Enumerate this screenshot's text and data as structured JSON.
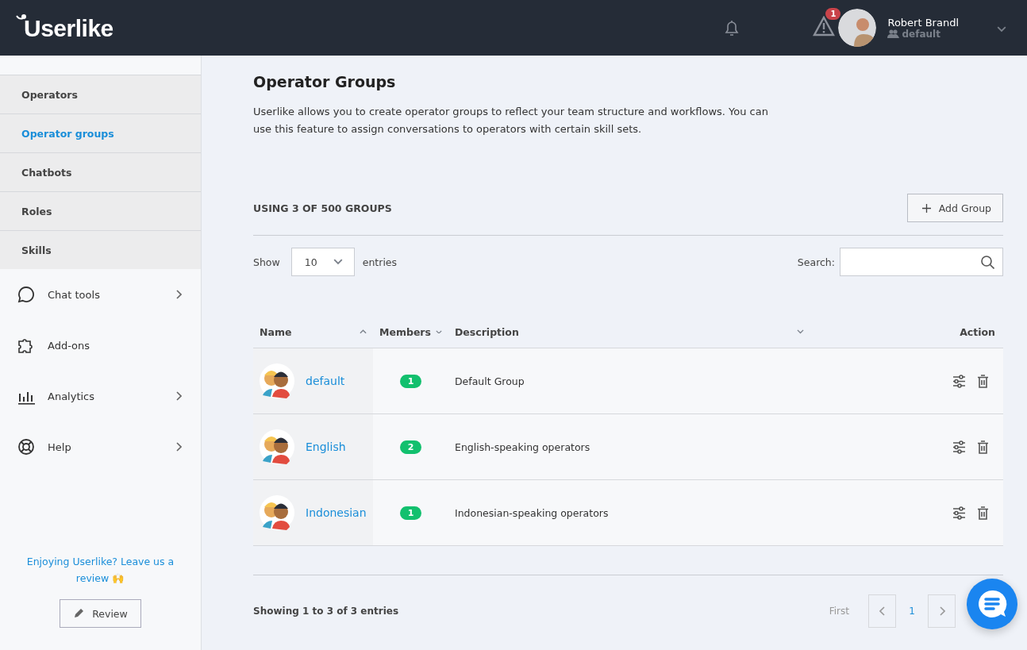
{
  "header": {
    "logo": "Userlike",
    "alert_count": "1",
    "user": {
      "name": "Robert Brandl",
      "group": "default"
    }
  },
  "sidebar": {
    "subitems": [
      {
        "label": "Operators",
        "selected": false
      },
      {
        "label": "Operator groups",
        "selected": true
      },
      {
        "label": "Chatbots",
        "selected": false
      },
      {
        "label": "Roles",
        "selected": false
      },
      {
        "label": "Skills",
        "selected": false
      }
    ],
    "items": [
      {
        "label": "Chat tools",
        "kind": "chat",
        "arrow": true
      },
      {
        "label": "Add-ons",
        "kind": "puzzle",
        "arrow": false
      },
      {
        "label": "Analytics",
        "kind": "bars",
        "arrow": true
      },
      {
        "label": "Help",
        "kind": "lifebuoy",
        "arrow": true
      }
    ],
    "review_prompt": "Enjoying Userlike? Leave us a review 🙌",
    "review_button": "Review"
  },
  "page": {
    "title": "Operator Groups",
    "description": "Userlike allows you to create operator groups to reflect your team structure and workflows. You can use this feature to assign conversations to operators with certain skill sets.",
    "usage": "USING 3 OF 500 GROUPS",
    "add_button": "Add Group",
    "show_label": "Show",
    "entries_value": "10",
    "entries_label": "entries",
    "search_label": "Search:"
  },
  "table": {
    "columns": [
      "Name",
      "Members",
      "Description",
      "Action"
    ],
    "rows": [
      {
        "name": "default",
        "members": "1",
        "description": "Default Group"
      },
      {
        "name": "English",
        "members": "2",
        "description": "English-speaking operators"
      },
      {
        "name": "Indonesian",
        "members": "1",
        "description": "Indonesian-speaking operators"
      }
    ]
  },
  "footer": {
    "info": "Showing 1 to 3 of 3 entries",
    "first": "First",
    "page": "1"
  }
}
